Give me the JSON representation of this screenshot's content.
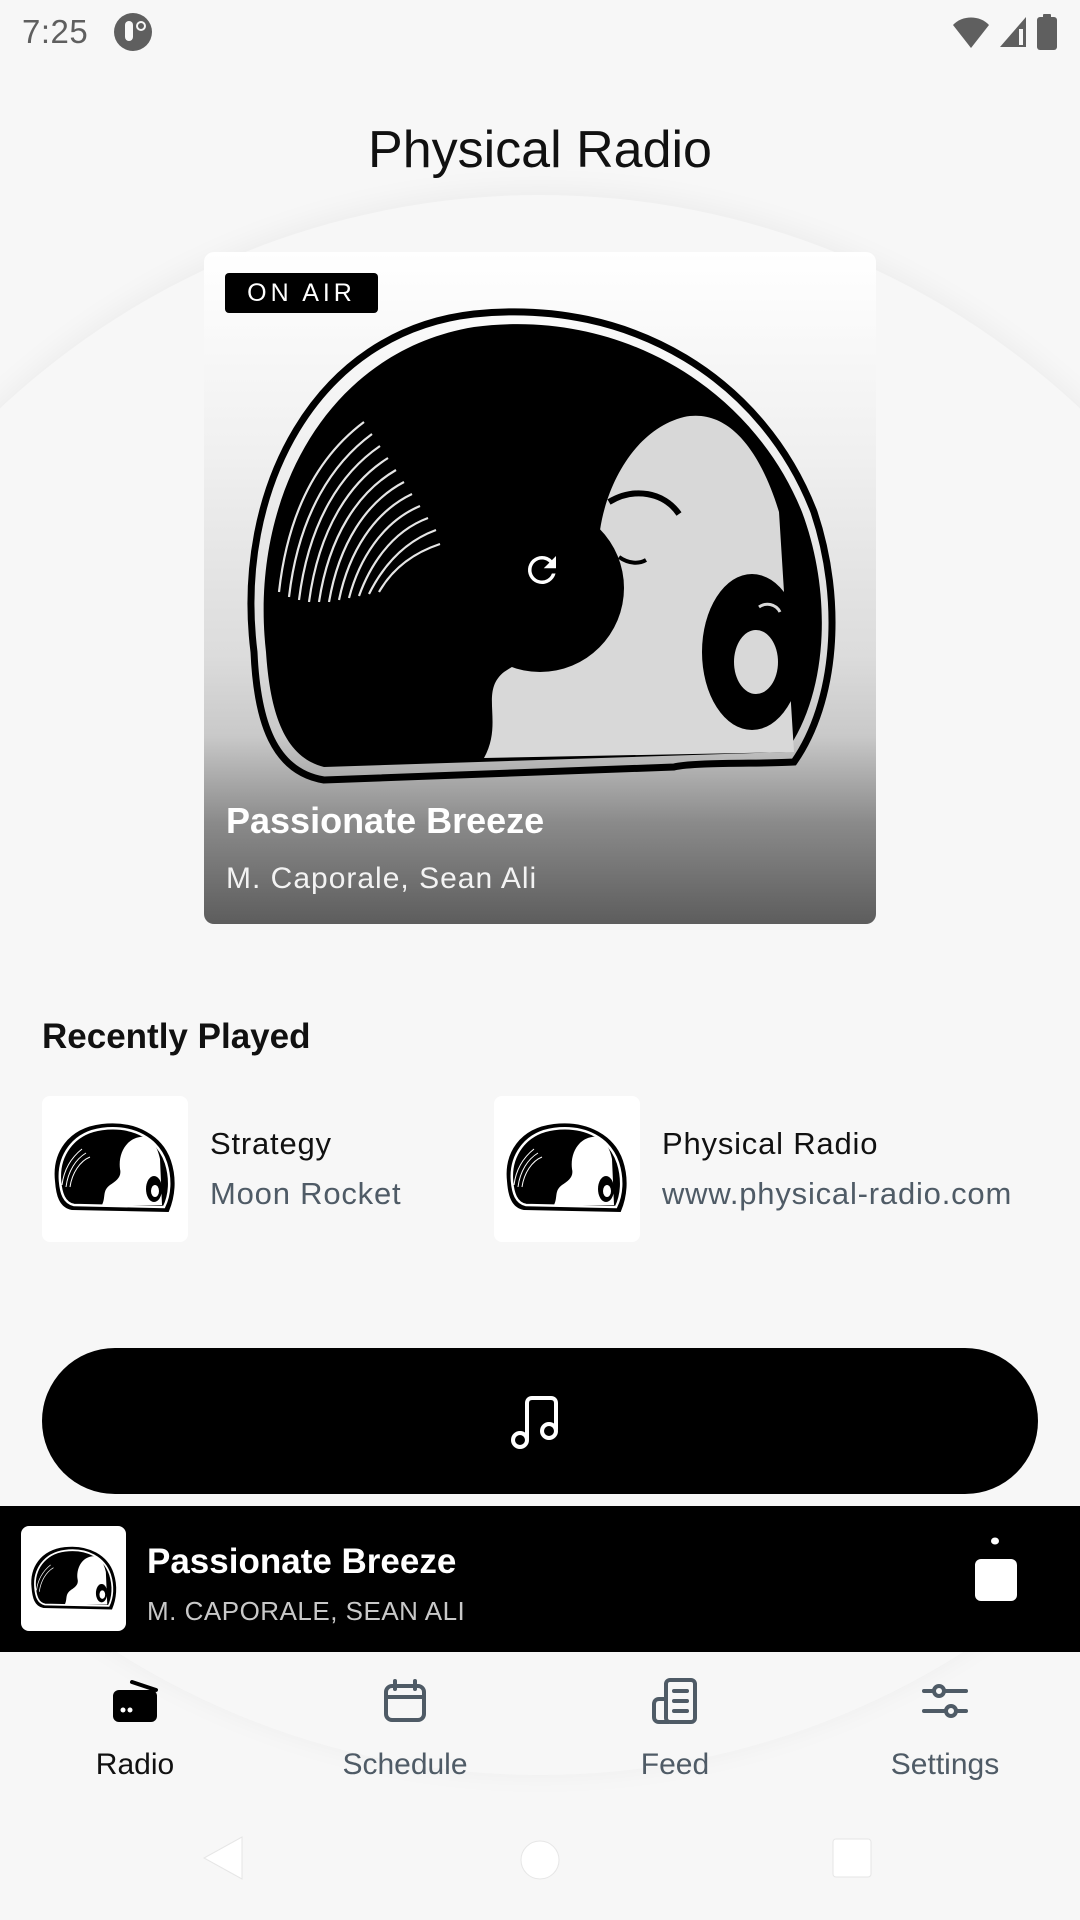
{
  "status_bar": {
    "time": "7:25",
    "icons": [
      "app-notification-icon",
      "wifi-icon",
      "cellular-signal-icon",
      "battery-icon"
    ]
  },
  "header": {
    "title": "Physical Radio"
  },
  "now_playing_card": {
    "badge": "ON AIR",
    "title": "Passionate Breeze",
    "artist": "M. Caporale, Sean Ali",
    "center_icon": "refresh-icon"
  },
  "recently_played": {
    "heading": "Recently Played",
    "items": [
      {
        "title": "Strategy",
        "subtitle": "Moon Rocket"
      },
      {
        "title": "Physical Radio",
        "subtitle": "www.physical-radio.com"
      }
    ]
  },
  "play_button": {
    "icon": "music-note-icon"
  },
  "mini_player": {
    "title": "Passionate Breeze",
    "artist": "M. CAPORALE, SEAN ALI",
    "control_icon": "stop-icon"
  },
  "bottom_nav": {
    "items": [
      {
        "label": "Radio",
        "icon": "radio-icon",
        "active": true
      },
      {
        "label": "Schedule",
        "icon": "calendar-icon",
        "active": false
      },
      {
        "label": "Feed",
        "icon": "newspaper-icon",
        "active": false
      },
      {
        "label": "Settings",
        "icon": "sliders-icon",
        "active": false
      }
    ]
  },
  "colors": {
    "background": "#f7f7f7",
    "primary": "#000000",
    "secondary_text": "#4f5b66",
    "status_gray": "#5f5f5f"
  }
}
